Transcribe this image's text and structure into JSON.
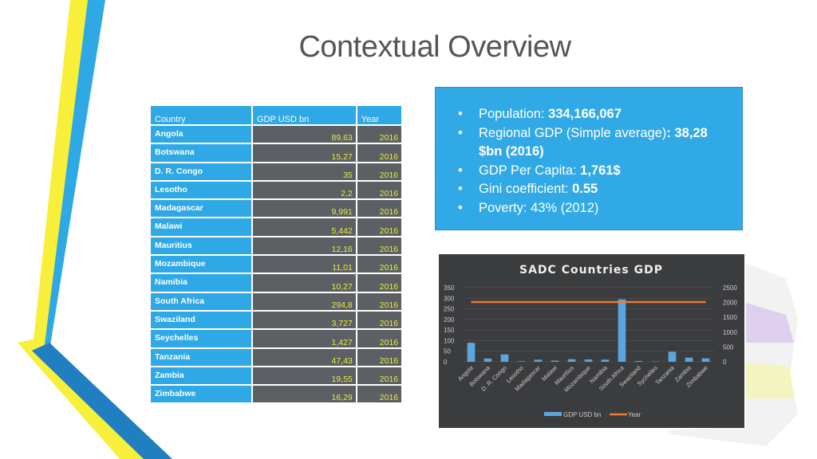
{
  "title": "Contextual Overview",
  "table": {
    "headers": [
      "Country",
      "GDP USD bn",
      "Year"
    ],
    "rows": [
      [
        "Angola",
        "89,63",
        "2016"
      ],
      [
        "Botswana",
        "15,27",
        "2016"
      ],
      [
        "D. R. Congo",
        "35",
        "2016"
      ],
      [
        "Lesotho",
        "2,2",
        "2016"
      ],
      [
        "Madagascar",
        "9,991",
        "2016"
      ],
      [
        "Malawi",
        "5,442",
        "2016"
      ],
      [
        "Mauritius",
        "12,16",
        "2016"
      ],
      [
        "Mozambique",
        "11,01",
        "2016"
      ],
      [
        "Namibia",
        "10,27",
        "2016"
      ],
      [
        "South Africa",
        "294,8",
        "2016"
      ],
      [
        "Swaziland",
        "3,727",
        "2016"
      ],
      [
        "Seychelles",
        "1,427",
        "2016"
      ],
      [
        "Tanzania",
        "47,43",
        "2016"
      ],
      [
        "Zambia",
        "19,55",
        "2016"
      ],
      [
        "Zimbabwe",
        "16,29",
        "2016"
      ]
    ]
  },
  "info": {
    "population_label": "Population: ",
    "population_value": "334,166,067",
    "gdp_label": "Regional GDP (Simple average)",
    "gdp_value": ": 38,28 $bn (2016)",
    "percap_label": "GDP Per Capita: ",
    "percap_value": "1,761$",
    "gini_label": "Gini coefficient: ",
    "gini_value": "0.55",
    "poverty": "Poverty: 43% (2012)"
  },
  "colors": {
    "accent_blue": "#2fa8e6",
    "bar": "#5aa6e0",
    "line": "#ed7d31",
    "yellow": "#f7ef3a"
  },
  "chart_data": {
    "type": "bar",
    "title": "SADC Countries GDP",
    "categories": [
      "Angola",
      "Botswana",
      "D. R. Congo",
      "Lesotho",
      "Madagascar",
      "Malawi",
      "Mauritius",
      "Mozambique",
      "Namibia",
      "South Africa",
      "Swaziland",
      "Sychelles",
      "Tanzania",
      "Zambia",
      "Zimbabwe"
    ],
    "series": [
      {
        "name": "GDP USD bn",
        "type": "bar",
        "axis": "left",
        "values": [
          89.63,
          15.27,
          35,
          2.2,
          9.991,
          5.442,
          12.16,
          11.01,
          10.27,
          294.8,
          3.727,
          1.427,
          47.43,
          19.55,
          16.29
        ]
      },
      {
        "name": "Year",
        "type": "line",
        "axis": "right",
        "values": [
          2016,
          2016,
          2016,
          2016,
          2016,
          2016,
          2016,
          2016,
          2016,
          2016,
          2016,
          2016,
          2016,
          2016,
          2016
        ]
      }
    ],
    "ylim": [
      0,
      350
    ],
    "yticks": [
      "0",
      "50",
      "100",
      "150",
      "200",
      "250",
      "300",
      "350"
    ],
    "y2lim": [
      0,
      2500
    ],
    "y2ticks": [
      "0",
      "500",
      "1000",
      "1500",
      "2000",
      "2500"
    ],
    "grid": true,
    "legend": "bottom"
  }
}
